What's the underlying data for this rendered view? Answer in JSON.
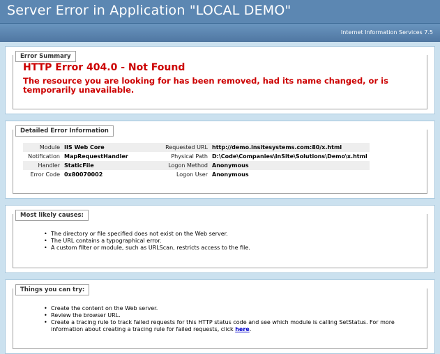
{
  "page": {
    "title": "Server Error in Application \"LOCAL DEMO\"",
    "server_version": "Internet Information Services 7.5"
  },
  "summary": {
    "legend": "Error Summary",
    "error_title": "HTTP Error 404.0 - Not Found",
    "error_desc": "The resource you are looking for has been removed, had its name changed, or is temporarily unavailable."
  },
  "detail": {
    "legend": "Detailed Error Information",
    "left": [
      {
        "label": "Module",
        "value": "IIS Web Core"
      },
      {
        "label": "Notification",
        "value": "MapRequestHandler"
      },
      {
        "label": "Handler",
        "value": "StaticFile"
      },
      {
        "label": "Error Code",
        "value": "0x80070002"
      }
    ],
    "right": [
      {
        "label": "Requested URL",
        "value": "http://demo.insitesystems.com:80/x.html"
      },
      {
        "label": "Physical Path",
        "value": "D:\\Code\\Companies\\InSite\\Solutions\\Demo\\x.html"
      },
      {
        "label": "Logon Method",
        "value": "Anonymous"
      },
      {
        "label": "Logon User",
        "value": "Anonymous"
      }
    ]
  },
  "causes": {
    "legend": "Most likely causes:",
    "items": [
      "The directory or file specified does not exist on the Web server.",
      "The URL contains a typographical error.",
      "A custom filter or module, such as URLScan, restricts access to the file."
    ]
  },
  "try": {
    "legend": "Things you can try:",
    "items": [
      "Create the content on the Web server.",
      "Review the browser URL."
    ],
    "tracing_text": "Create a tracing rule to track failed requests for this HTTP status code and see which module is calling SetStatus. For more information about creating a tracing rule for failed requests, click ",
    "tracing_link": "here",
    "tracing_end": "."
  }
}
